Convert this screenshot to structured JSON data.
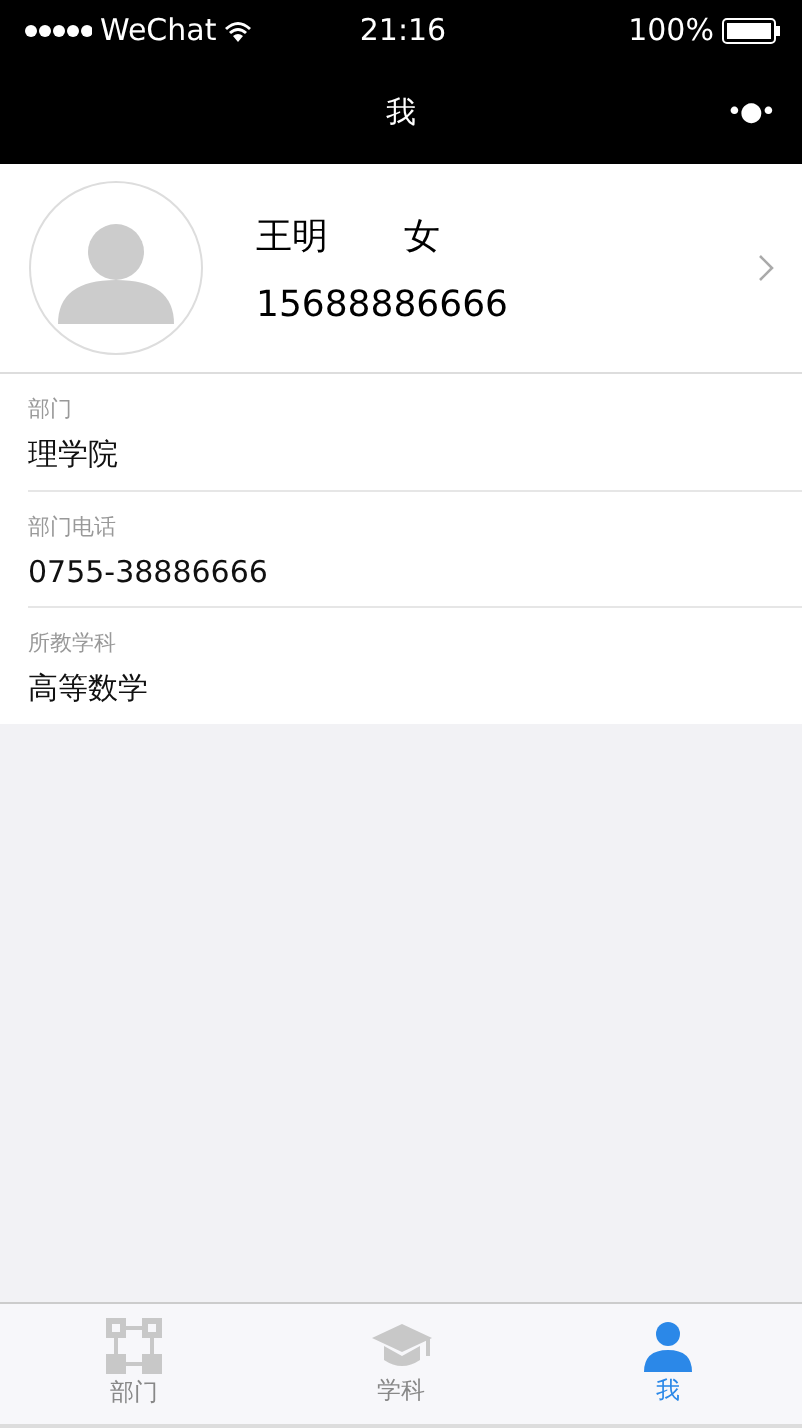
{
  "status_bar": {
    "carrier": "WeChat",
    "time": "21:16",
    "battery": "100%"
  },
  "nav_bar": {
    "title": "我",
    "menu": "•●•"
  },
  "profile": {
    "name": "王明",
    "gender": "女",
    "phone": "15688886666"
  },
  "fields": [
    {
      "label": "部门",
      "value": "理学院"
    },
    {
      "label": "部门电话",
      "value": "0755-38886666"
    },
    {
      "label": "所教学科",
      "value": "高等数学"
    }
  ],
  "tabs": [
    {
      "kind": "org",
      "label": "部门",
      "selected": false
    },
    {
      "kind": "subject",
      "label": "学科",
      "selected": false
    },
    {
      "kind": "me",
      "label": "我",
      "selected": true
    }
  ]
}
